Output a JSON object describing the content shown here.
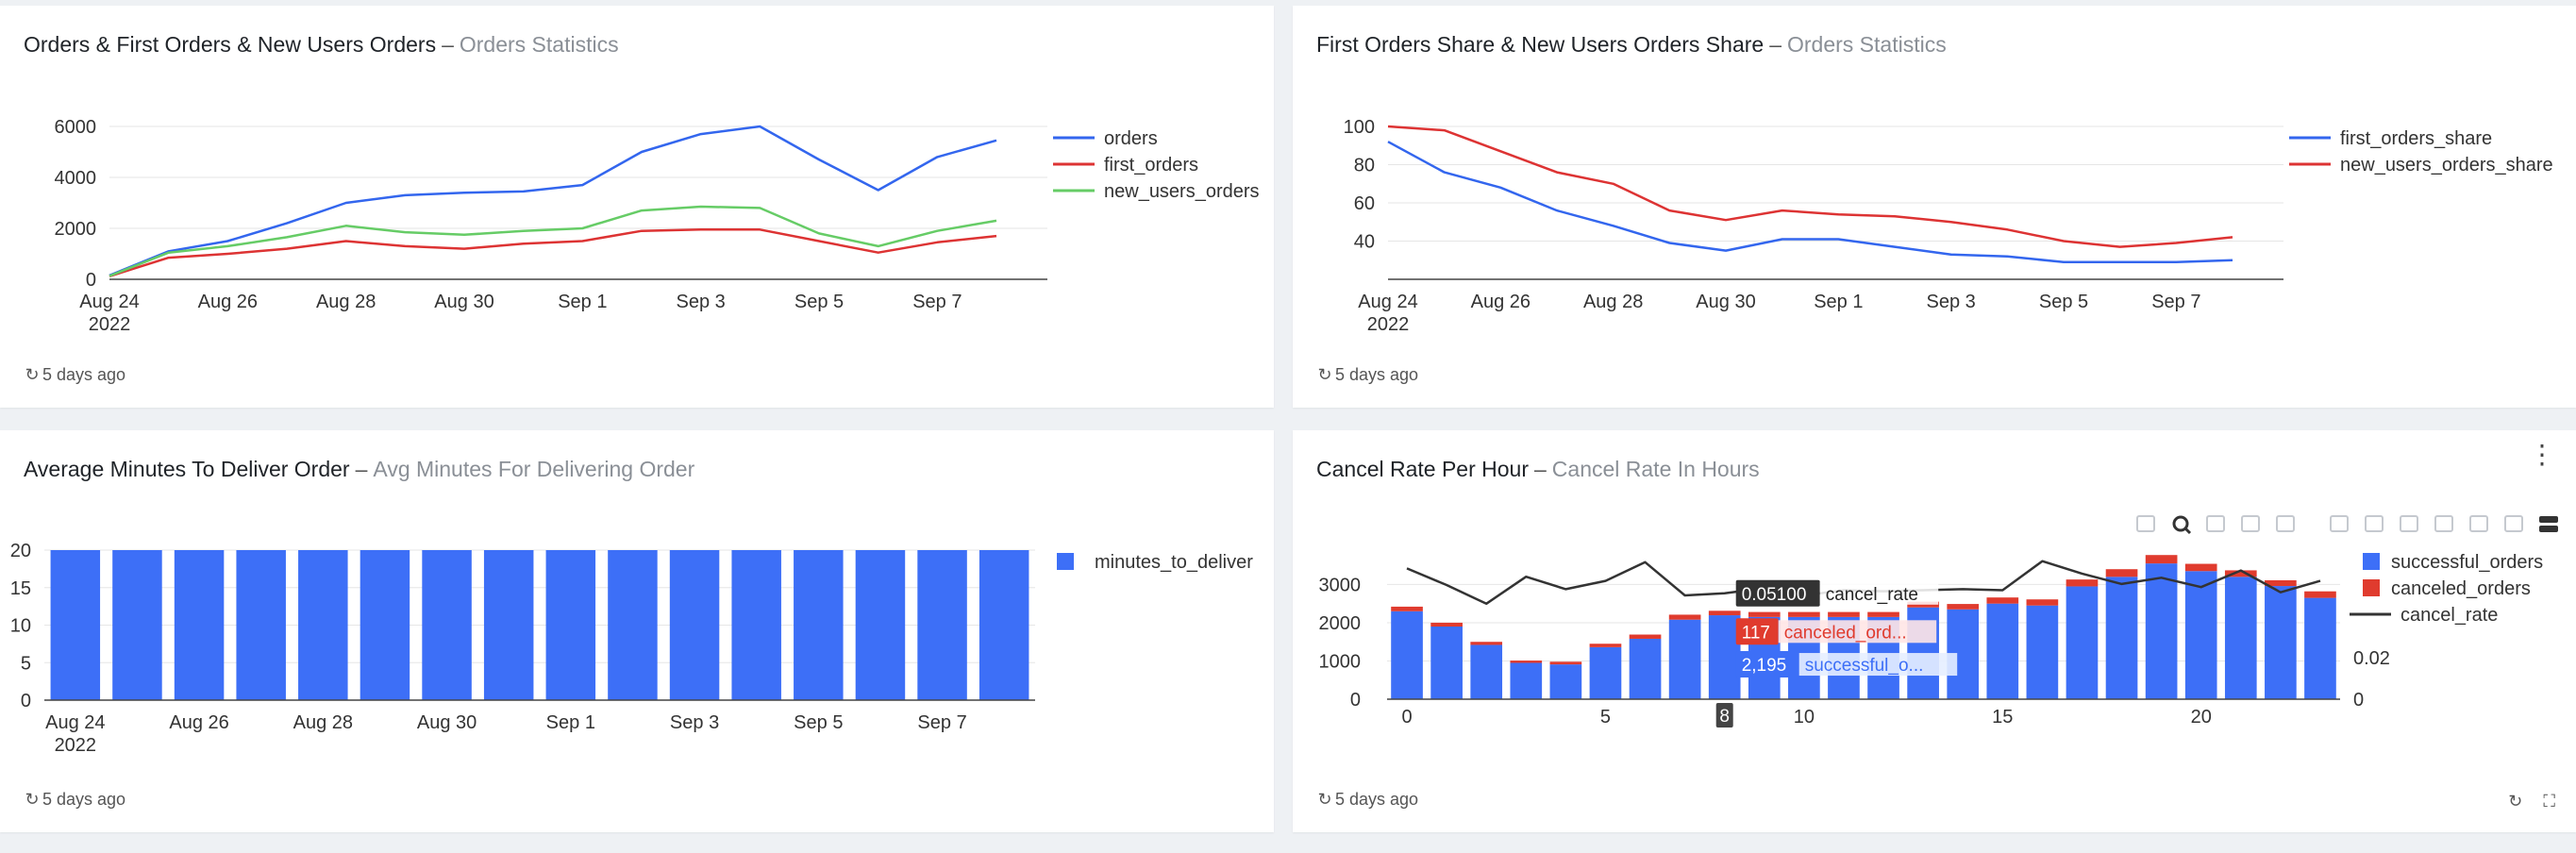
{
  "panels": [
    {
      "title": "Orders & First Orders & New Users Orders",
      "separator": "–",
      "subtitle": "Orders Statistics",
      "refresh_text": "5 days ago"
    },
    {
      "title": "First Orders Share & New Users Orders Share",
      "separator": "–",
      "subtitle": "Orders Statistics",
      "refresh_text": "5 days ago"
    },
    {
      "title": "Average Minutes To Deliver Order",
      "separator": "–",
      "subtitle": "Avg Minutes For Delivering Order",
      "refresh_text": "5 days ago"
    },
    {
      "title": "Cancel Rate Per Hour",
      "separator": "–",
      "subtitle": "Cancel Rate In Hours",
      "refresh_text": "5 days ago"
    }
  ],
  "icons": {
    "refresh": "refresh-icon",
    "menu": "kebab-menu-icon",
    "toolbar": [
      "camera-icon",
      "zoom-icon",
      "pan-icon",
      "box-select-icon",
      "lasso-icon",
      "zoom-in-icon",
      "zoom-out-icon",
      "autoscale-icon",
      "home-icon",
      "spike-lines-icon",
      "hover-closest-icon",
      "hover-compare-icon"
    ]
  },
  "chart_data": [
    {
      "type": "line",
      "x": [
        "Aug 24",
        "Aug 25",
        "Aug 26",
        "Aug 27",
        "Aug 28",
        "Aug 29",
        "Aug 30",
        "Aug 31",
        "Sep 1",
        "Sep 2",
        "Sep 3",
        "Sep 4",
        "Sep 5",
        "Sep 6",
        "Sep 7",
        "Sep 8"
      ],
      "x_tick_labels": [
        "Aug 24",
        "Aug 26",
        "Aug 28",
        "Aug 30",
        "Sep 1",
        "Sep 3",
        "Sep 5",
        "Sep 7"
      ],
      "x_year_label": "2022",
      "y_ticks": [
        0,
        2000,
        4000,
        6000
      ],
      "ylim": [
        0,
        6000
      ],
      "legend": "right",
      "series": [
        {
          "name": "orders",
          "color": "#3366ee",
          "values": [
            150,
            1100,
            1500,
            2200,
            3000,
            3300,
            3400,
            3450,
            3700,
            5000,
            5700,
            6000,
            4700,
            3500,
            4800,
            5450
          ]
        },
        {
          "name": "first_orders",
          "color": "#dd3333",
          "values": [
            120,
            850,
            1000,
            1200,
            1500,
            1300,
            1200,
            1400,
            1500,
            1900,
            1950,
            1950,
            1500,
            1050,
            1450,
            1700
          ]
        },
        {
          "name": "new_users_orders",
          "color": "#66cc66",
          "values": [
            130,
            1050,
            1300,
            1650,
            2100,
            1850,
            1750,
            1900,
            2000,
            2700,
            2850,
            2800,
            1800,
            1300,
            1900,
            2300
          ]
        }
      ]
    },
    {
      "type": "line",
      "x": [
        "Aug 24",
        "Aug 25",
        "Aug 26",
        "Aug 27",
        "Aug 28",
        "Aug 29",
        "Aug 30",
        "Aug 31",
        "Sep 1",
        "Sep 2",
        "Sep 3",
        "Sep 4",
        "Sep 5",
        "Sep 6",
        "Sep 7",
        "Sep 8"
      ],
      "x_tick_labels": [
        "Aug 24",
        "Aug 26",
        "Aug 28",
        "Aug 30",
        "Sep 1",
        "Sep 3",
        "Sep 5",
        "Sep 7"
      ],
      "x_year_label": "2022",
      "y_ticks": [
        40,
        60,
        80,
        100
      ],
      "ylim": [
        20,
        100
      ],
      "legend": "right",
      "series": [
        {
          "name": "first_orders_share",
          "color": "#3366ee",
          "values": [
            92,
            76,
            68,
            56,
            48,
            39,
            35,
            41,
            41,
            37,
            33,
            32,
            29,
            29,
            29,
            30
          ]
        },
        {
          "name": "new_users_orders_share",
          "color": "#dd3333",
          "values": [
            100,
            98,
            87,
            76,
            70,
            56,
            51,
            56,
            54,
            53,
            50,
            46,
            40,
            37,
            39,
            42
          ]
        }
      ]
    },
    {
      "type": "bar",
      "x": [
        "Aug 24",
        "Aug 25",
        "Aug 26",
        "Aug 27",
        "Aug 28",
        "Aug 29",
        "Aug 30",
        "Aug 31",
        "Sep 1",
        "Sep 2",
        "Sep 3",
        "Sep 4",
        "Sep 5",
        "Sep 6",
        "Sep 7",
        "Sep 8"
      ],
      "x_tick_labels": [
        "Aug 24",
        "Aug 26",
        "Aug 28",
        "Aug 30",
        "Sep 1",
        "Sep 3",
        "Sep 5",
        "Sep 7"
      ],
      "x_year_label": "2022",
      "y_ticks": [
        0,
        5,
        10,
        15,
        20
      ],
      "ylim": [
        0,
        20
      ],
      "legend": "right",
      "series": [
        {
          "name": "minutes_to_deliver",
          "color": "#3d6ff7",
          "values": [
            20,
            20,
            20,
            20,
            20,
            20,
            20,
            20,
            20,
            20,
            20,
            20,
            20,
            20,
            20,
            20
          ]
        }
      ]
    },
    {
      "type": "bar",
      "stacked": true,
      "x": [
        0,
        1,
        2,
        3,
        4,
        5,
        6,
        7,
        8,
        9,
        10,
        11,
        12,
        13,
        14,
        15,
        16,
        17,
        18,
        19,
        20,
        21,
        22,
        23
      ],
      "x_ticks": [
        0,
        5,
        10,
        15,
        20
      ],
      "y_ticks": [
        0,
        1000,
        2000,
        3000
      ],
      "ylim": [
        0,
        3800
      ],
      "y2_ticks": [
        0,
        0.02
      ],
      "y2_tick_labels": [
        "0",
        "0.02"
      ],
      "y2lim": [
        0,
        0.07
      ],
      "legend": "right",
      "hover": {
        "x": 8,
        "x_label": "8",
        "cancel_rate_value": "0.05100",
        "cancel_rate_label": "cancel_rate",
        "canceled_value": "117",
        "canceled_label": "canceled_ord...",
        "successful_value": "2,195",
        "successful_label": "successful_o..."
      },
      "series": [
        {
          "name": "successful_orders",
          "color": "#3d6ff7",
          "values": [
            2300,
            1900,
            1420,
            950,
            910,
            1360,
            1580,
            2080,
            2195,
            2150,
            2150,
            2150,
            2150,
            2400,
            2350,
            2500,
            2450,
            2950,
            3200,
            3550,
            3350,
            3200,
            2960,
            2650
          ]
        },
        {
          "name": "canceled_orders",
          "color": "#e03b2e",
          "values": [
            120,
            100,
            80,
            60,
            70,
            90,
            110,
            130,
            117,
            130,
            130,
            130,
            130,
            150,
            140,
            160,
            160,
            180,
            200,
            220,
            190,
            170,
            150,
            170
          ]
        },
        {
          "name": "cancel_rate",
          "color": "#333333",
          "axis": "y2",
          "values": [
            0.063,
            0.055,
            0.046,
            0.059,
            0.053,
            0.057,
            0.066,
            0.05,
            0.051,
            0.0535,
            0.05,
            0.0525,
            0.052,
            0.0525,
            0.053,
            0.0525,
            0.0665,
            0.0605,
            0.0555,
            0.0585,
            0.054,
            0.062,
            0.0515,
            0.057
          ]
        }
      ]
    }
  ]
}
